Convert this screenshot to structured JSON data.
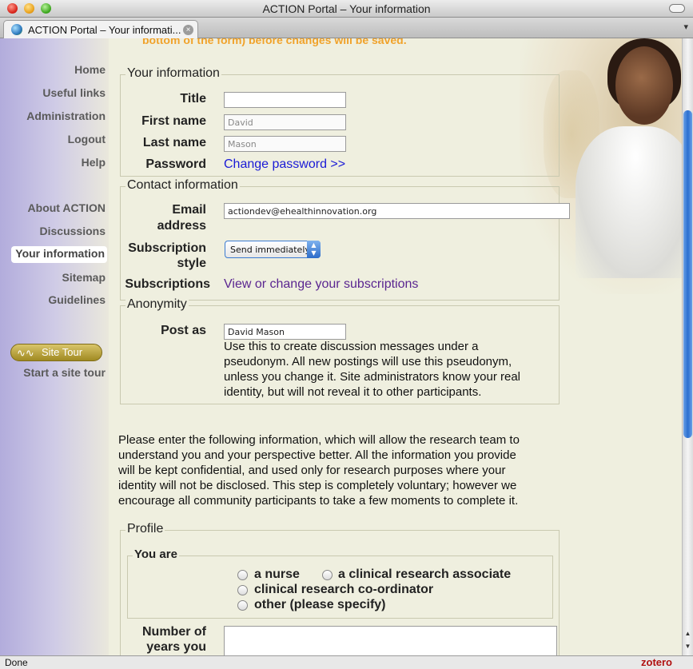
{
  "window": {
    "title": "ACTION Portal – Your information"
  },
  "tab": {
    "label": "ACTION Portal – Your informati...",
    "close_glyph": "×",
    "dropdown_glyph": "▾"
  },
  "sidebar": {
    "links": [
      "Home",
      "Useful links",
      "Administration",
      "Logout",
      "Help"
    ],
    "sections": [
      "About ACTION",
      "Discussions",
      "Your information",
      "Sitemap",
      "Guidelines"
    ],
    "active": "Your information",
    "site_tour_button": "Site Tour",
    "site_tour_link": "Start a site tour"
  },
  "notice": "bottom of the form) before changes will be saved.",
  "your_information": {
    "legend": "Your information",
    "title_label": "Title",
    "title_value": "",
    "first_name_label": "First name",
    "first_name_value": "David",
    "last_name_label": "Last name",
    "last_name_value": "Mason",
    "password_label": "Password",
    "password_link": "Change password >>"
  },
  "contact_information": {
    "legend": "Contact information",
    "email_label_1": "Email",
    "email_label_2": "address",
    "email_value": "actiondev@ehealthinnovation.org",
    "subscription_label_1": "Subscription",
    "subscription_label_2": "style",
    "subscription_value": "Send immediately",
    "subscriptions_label": "Subscriptions",
    "subscriptions_link": "View or change your subscriptions"
  },
  "anonymity": {
    "legend": "Anonymity",
    "post_as_label": "Post as",
    "post_as_value": "David Mason",
    "help_lines": [
      "Use this to create discussion messages under a",
      "pseudonym. All new postings will use this pseudonym,",
      "unless you change it. Site administrators know your real",
      "identity, but will not reveal it to other participants."
    ]
  },
  "research_intro": [
    "Please enter the following information, which will allow the research team to",
    "understand you and your perspective better. All the information you provide",
    "will be kept confidential, and used only for research purposes where your",
    "identity will not be disclosed. This step is completely voluntary; however we",
    "encourage all community participants to take a few moments to complete it."
  ],
  "profile": {
    "legend": "Profile",
    "you_are_legend": "You are",
    "options": [
      "a nurse",
      "a clinical research associate",
      "clinical research co-ordinator",
      "other (please specify)"
    ],
    "years_label_1": "Number of",
    "years_label_2": "years you"
  },
  "status": {
    "text": "Done",
    "zotero": "zotero"
  }
}
